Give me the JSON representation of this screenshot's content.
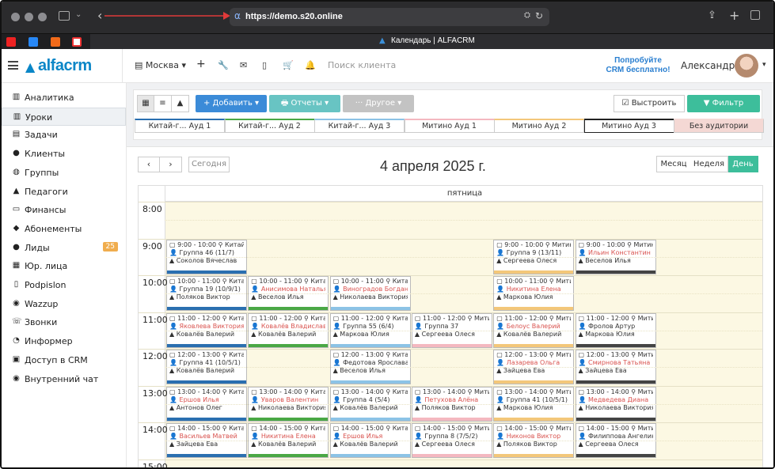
{
  "browser": {
    "url": "https://demo.s20.online",
    "tab_title": "Календарь | ALFACRM"
  },
  "header": {
    "logo": "alfacrm",
    "branch": "Москва",
    "search_placeholder": "Поиск клиента",
    "promo_line1": "Попробуйте",
    "promo_line2": "CRM бесплатно!",
    "user": "Александра"
  },
  "sidebar": {
    "items": [
      {
        "label": "Аналитика",
        "icon": "book-icon"
      },
      {
        "label": "Уроки",
        "icon": "book-icon",
        "active": true
      },
      {
        "label": "Задачи",
        "icon": "tasks-icon"
      },
      {
        "label": "Клиенты",
        "icon": "user-icon"
      },
      {
        "label": "Группы",
        "icon": "users-icon"
      },
      {
        "label": "Педагоги",
        "icon": "cap-icon"
      },
      {
        "label": "Финансы",
        "icon": "money-icon"
      },
      {
        "label": "Абонементы",
        "icon": "ticket-icon"
      },
      {
        "label": "Лиды",
        "icon": "user-icon",
        "badge": "25"
      },
      {
        "label": "Юр. лица",
        "icon": "building-icon"
      },
      {
        "label": "Podpislon",
        "icon": "doc-icon"
      },
      {
        "label": "Wazzup",
        "icon": "chat-icon"
      },
      {
        "label": "Звонки",
        "icon": "phone-icon"
      },
      {
        "label": "Информер",
        "icon": "bell-icon"
      },
      {
        "label": "Доступ в CRM",
        "icon": "lock-icon"
      },
      {
        "label": "Внутренний чат",
        "icon": "chat-icon"
      }
    ]
  },
  "toolbar": {
    "add": "+ Добавить ▾",
    "reports": "🖶 Отчеты ▾",
    "other": "··· Другое ▾",
    "align": "☑ Выстроить",
    "filter": "▼ Фильтр",
    "rooms": [
      {
        "label": "Китай-г... Ауд 1",
        "color": "#2a6fb0"
      },
      {
        "label": "Китай-г... Ауд 2",
        "color": "#4aa845"
      },
      {
        "label": "Китай-г... Ауд 3",
        "color": "#8cc3e6"
      },
      {
        "label": "Митино Ауд 1",
        "color": "#f4b8c0"
      },
      {
        "label": "Митино Ауд 2",
        "color": "#f3c77a"
      },
      {
        "label": "Митино Ауд 3",
        "color": "#444444"
      },
      {
        "label": "Без аудитории",
        "color": "#f4d8d4"
      }
    ]
  },
  "calendar": {
    "today": "Сегодня",
    "date_title": "4 апреля 2025 г.",
    "views": [
      "Месяц",
      "Неделя",
      "День"
    ],
    "active_view": "День",
    "day_header": "пятница",
    "times": [
      "8:00",
      "9:00",
      "10:00",
      "11:00",
      "12:00",
      "13:00",
      "14:00",
      "15:00"
    ],
    "events": [
      {
        "col": 0,
        "row": 1,
        "time": "9:00 - 10:00",
        "loc": "Китай-гор",
        "l2": "Группа 46 (11/7)",
        "l2red": false,
        "l3": "Соколов Вячеслав",
        "color": "#2a6fb0"
      },
      {
        "col": 4,
        "row": 1,
        "time": "9:00 - 10:00",
        "loc": "Митино Ау",
        "l2": "Группа 9 (13/11)",
        "l2red": false,
        "l3": "Сергеева Олеся",
        "color": "#f3c77a"
      },
      {
        "col": 5,
        "row": 1,
        "time": "9:00 - 10:00",
        "loc": "Митино Ау",
        "l2": "Ильин Константин",
        "l2red": true,
        "l3": "Веселов Илья",
        "color": "#444444"
      },
      {
        "col": 0,
        "row": 2,
        "time": "10:00 - 11:00",
        "loc": "Китай-гор",
        "l2": "Группа 19 (10/9/1)",
        "l2red": false,
        "l3": "Поляков Виктор",
        "color": "#2a6fb0"
      },
      {
        "col": 1,
        "row": 2,
        "time": "10:00 - 11:00",
        "loc": "Китай-гор",
        "l2": "Анисимова Наталья",
        "l2red": true,
        "l3": "Веселов Илья",
        "color": "#4aa845"
      },
      {
        "col": 2,
        "row": 2,
        "time": "10:00 - 11:00",
        "loc": "Китай-гор",
        "l2": "Виноградов Богдан",
        "l2red": true,
        "l3": "Николаева Виктория",
        "color": "#8cc3e6"
      },
      {
        "col": 4,
        "row": 2,
        "time": "10:00 - 11:00",
        "loc": "Митино Ау",
        "l2": "Никитина Елена",
        "l2red": true,
        "l3": "Маркова Юлия",
        "color": "#f3c77a"
      },
      {
        "col": 0,
        "row": 3,
        "time": "11:00 - 12:00",
        "loc": "Китай-гор",
        "l2": "Яковлева Виктория",
        "l2red": true,
        "l3": "Ковалёв Валерий",
        "color": "#2a6fb0"
      },
      {
        "col": 1,
        "row": 3,
        "time": "11:00 - 12:00",
        "loc": "Китай-гор",
        "l2": "Ковалёв Владислав",
        "l2red": true,
        "l3": "Ковалёв Валерий",
        "color": "#4aa845"
      },
      {
        "col": 2,
        "row": 3,
        "time": "11:00 - 12:00",
        "loc": "Китай-гор",
        "l2": "Группа 55 (6/4)",
        "l2red": false,
        "l3": "Маркова Юлия",
        "color": "#8cc3e6"
      },
      {
        "col": 3,
        "row": 3,
        "time": "11:00 - 12:00",
        "loc": "Митино Ау",
        "l2": "Группа 37",
        "l2red": false,
        "l3": "Сергеева Олеся",
        "color": "#f4b8c0"
      },
      {
        "col": 4,
        "row": 3,
        "time": "11:00 - 12:00",
        "loc": "Митино Ау",
        "l2": "Белоус Валерий",
        "l2red": true,
        "l3": "Ковалёв Валерий",
        "color": "#f3c77a"
      },
      {
        "col": 5,
        "row": 3,
        "time": "11:00 - 12:00",
        "loc": "Митино Ау",
        "l2": "Фролов Артур",
        "l2red": false,
        "l3": "Маркова Юлия",
        "color": "#444444"
      },
      {
        "col": 0,
        "row": 4,
        "time": "12:00 - 13:00",
        "loc": "Китай-гор",
        "l2": "Группа 41 (10/5/1)",
        "l2red": false,
        "l3": "Ковалёв Валерий",
        "color": "#2a6fb0"
      },
      {
        "col": 2,
        "row": 4,
        "time": "12:00 - 13:00",
        "loc": "Китай-гор",
        "l2": "Федотова Ярослава",
        "l2red": false,
        "l3": "Веселов Илья",
        "color": "#8cc3e6"
      },
      {
        "col": 4,
        "row": 4,
        "time": "12:00 - 13:00",
        "loc": "Митино Ау",
        "l2": "Лазарева Ольга",
        "l2red": true,
        "l3": "Зайцева Ева",
        "color": "#f3c77a"
      },
      {
        "col": 5,
        "row": 4,
        "time": "12:00 - 13:00",
        "loc": "Митино Ау",
        "l2": "Смирнова Татьяна",
        "l2red": true,
        "l3": "Зайцева Ева",
        "color": "#444444"
      },
      {
        "col": 0,
        "row": 5,
        "time": "13:00 - 14:00",
        "loc": "Китай-гор",
        "l2": "Ершов Илья",
        "l2red": true,
        "l3": "Антонов Олег",
        "color": "#2a6fb0"
      },
      {
        "col": 1,
        "row": 5,
        "time": "13:00 - 14:00",
        "loc": "Китай-гор",
        "l2": "Уваров Валентин",
        "l2red": true,
        "l3": "Николаева Виктория",
        "color": "#4aa845"
      },
      {
        "col": 2,
        "row": 5,
        "time": "13:00 - 14:00",
        "loc": "Китай-гор",
        "l2": "Группа 4 (5/4)",
        "l2red": false,
        "l3": "Ковалёв Валерий",
        "color": "#8cc3e6"
      },
      {
        "col": 3,
        "row": 5,
        "time": "13:00 - 14:00",
        "loc": "Митино Ау",
        "l2": "Петухова Алёна",
        "l2red": true,
        "l3": "Поляков Виктор",
        "color": "#f4b8c0"
      },
      {
        "col": 4,
        "row": 5,
        "time": "13:00 - 14:00",
        "loc": "Митино Ау",
        "l2": "Группа 41 (10/5/1)",
        "l2red": false,
        "l3": "Маркова Юлия",
        "color": "#f3c77a"
      },
      {
        "col": 5,
        "row": 5,
        "time": "13:00 - 14:00",
        "loc": "Митино Ау",
        "l2": "Медведева Диана",
        "l2red": true,
        "l3": "Николаева Виктория",
        "color": "#444444"
      },
      {
        "col": 0,
        "row": 6,
        "time": "14:00 - 15:00",
        "loc": "Китай-гор",
        "l2": "Васильев Матвей",
        "l2red": true,
        "l3": "Зайцева Ева",
        "color": "#2a6fb0"
      },
      {
        "col": 1,
        "row": 6,
        "time": "14:00 - 15:00",
        "loc": "Китай-гор",
        "l2": "Никитина Елена",
        "l2red": true,
        "l3": "Ковалёв Валерий",
        "color": "#4aa845"
      },
      {
        "col": 2,
        "row": 6,
        "time": "14:00 - 15:00",
        "loc": "Китай-гор",
        "l2": "Ершов Илья",
        "l2red": true,
        "l3": "Ковалёв Валерий",
        "color": "#8cc3e6"
      },
      {
        "col": 3,
        "row": 6,
        "time": "14:00 - 15:00",
        "loc": "Митино Ау",
        "l2": "Группа 8 (7/5/2)",
        "l2red": false,
        "l3": "Сергеева Олеся",
        "color": "#f4b8c0"
      },
      {
        "col": 4,
        "row": 6,
        "time": "14:00 - 15:00",
        "loc": "Митино Ау",
        "l2": "Никонов Виктор",
        "l2red": true,
        "l3": "Поляков Виктор",
        "color": "#f3c77a"
      },
      {
        "col": 5,
        "row": 6,
        "time": "14:00 - 15:00",
        "loc": "Митино Ау",
        "l2": "Филиппова Ангелина",
        "l2red": false,
        "l3": "Сергеева Олеся",
        "color": "#444444"
      }
    ]
  }
}
